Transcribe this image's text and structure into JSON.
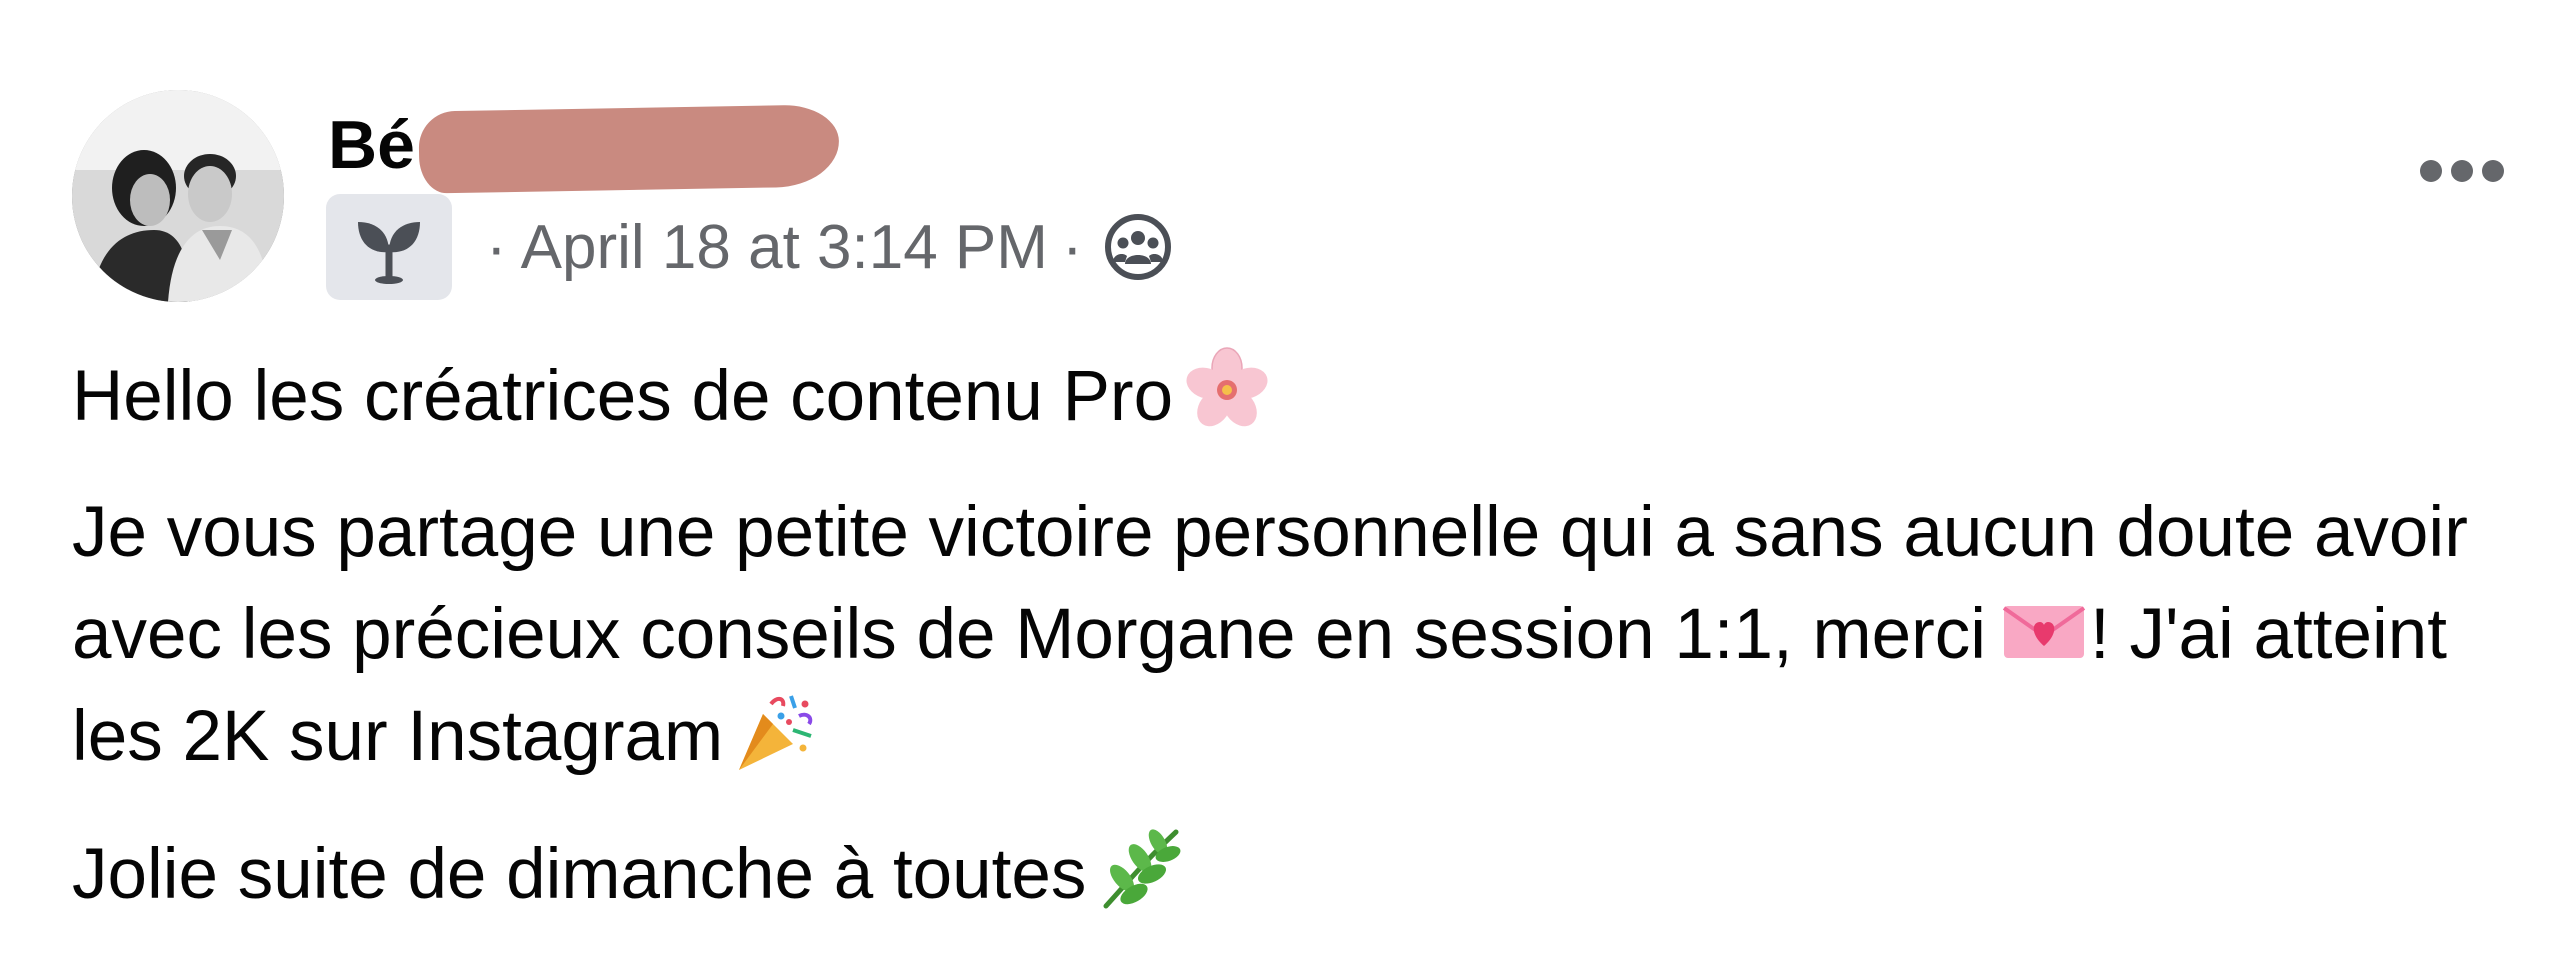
{
  "post": {
    "author_name_visible": "Bé",
    "timestamp": "April 18 at 3:14 PM",
    "separator": "·",
    "icons": {
      "badge": "sprout-icon",
      "audience": "group-icon",
      "menu": "more-options-icon"
    },
    "body": {
      "line1_text": "Hello les créatrices de contenu Pro",
      "line1_emoji": "cherry-blossom-icon",
      "para2_text_a": "Je vous partage une petite victoire personnelle qui a sans aucun doute avoir avec les précieux conseils de Morgane en session 1:1, merci",
      "para2_text_b": "! J'ai atteint les 2K sur Instagram",
      "para2_emoji_a": "love-letter-icon",
      "para2_emoji_b": "party-popper-icon",
      "line3_text": "Jolie suite de dimanche à toutes",
      "line3_emoji": "herb-icon"
    },
    "colors": {
      "text": "#050505",
      "secondary": "#65676b",
      "badge_bg": "#e4e6eb",
      "redaction": "#c98a80"
    }
  }
}
